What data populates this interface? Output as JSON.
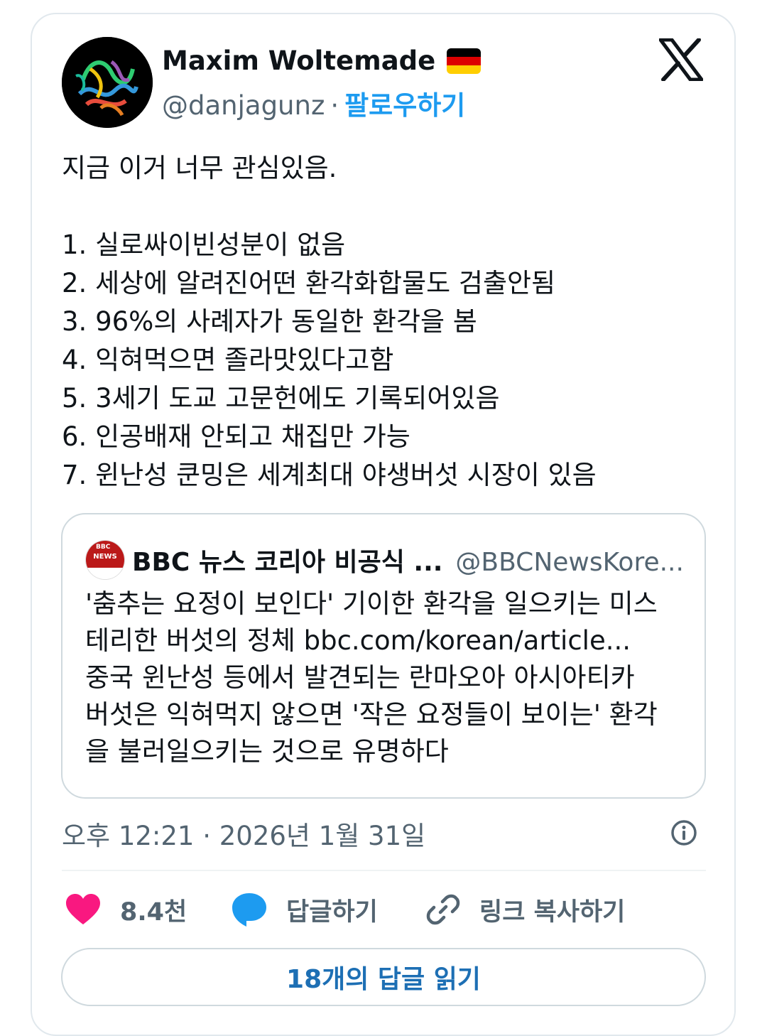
{
  "author": {
    "display_name": "Maxim Woltemade",
    "handle": "@danjagunz",
    "separator": "·",
    "follow_label": "팔로우하기",
    "flag_icon": "germany-flag-icon"
  },
  "platform_logo": "x-logo-icon",
  "tweet": {
    "text": "지금 이거 너무 관심있음.\n\n1. 실로싸이빈성분이 없음\n2. 세상에 알려진어떤 환각화합물도 검출안됨\n3. 96%의 사례자가 동일한 환각을 봄\n4. 익혀먹으면 졸라맛있다고함\n5. 3세기 도교 고문헌에도 기록되어있음\n6. 인공배재 안되고 채집만 가능\n7. 윈난성 쿤밍은 세계최대 야생버섯 시장이 있음"
  },
  "quote": {
    "name": "BBC 뉴스 코리아 비공식 ...",
    "handle": "@BBCNewsKore...",
    "avatar_text_top": "BBC",
    "avatar_text": "NEWS",
    "text": "'춤추는 요정이 보인다' 기이한 환각을 일으키는 미스\n테리한 버섯의 정체 bbc.com/korean/article...\n중국 윈난성 등에서 발견되는 란마오아 아시아티카\n버섯은 익혀먹지 않으면 '작은 요정들이 보이는' 환각\n을 불러일으키는 것으로 유명하다"
  },
  "timestamp": "오후 12:21 · 2026년 1월 31일",
  "actions": {
    "like_count": "8.4천",
    "reply_label": "답글하기",
    "copy_link_label": "링크 복사하기"
  },
  "read_replies_label": "18개의 답글 읽기",
  "colors": {
    "accent": "#1d9bf0",
    "like": "#f91880",
    "reply": "#1d9bf0",
    "muted": "#536471"
  }
}
